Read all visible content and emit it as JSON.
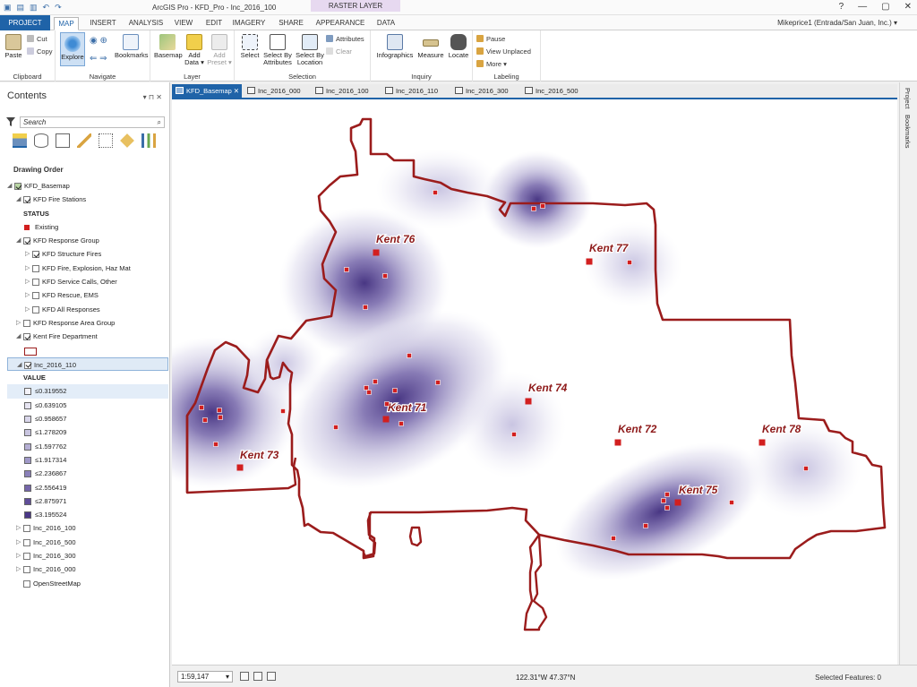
{
  "titlebar": {
    "title": "ArcGIS Pro - KFD_Pro - Inc_2016_100",
    "context_tab": "RASTER LAYER",
    "window_controls": [
      "?",
      "—",
      "▢",
      "✕"
    ]
  },
  "ribbon_tabs": [
    "PROJECT",
    "MAP",
    "INSERT",
    "ANALYSIS",
    "VIEW",
    "EDIT",
    "IMAGERY",
    "SHARE",
    "APPEARANCE",
    "DATA"
  ],
  "user": "Mikeprice1 (Entrada/San Juan, Inc.) ▾",
  "ribbon": {
    "clipboard": {
      "label": "Clipboard",
      "paste": "Paste",
      "cut": "Cut",
      "copy": "Copy"
    },
    "navigate": {
      "label": "Navigate",
      "explore": "Explore",
      "bookmarks": "Bookmarks"
    },
    "layer": {
      "label": "Layer",
      "basemap": "Basemap",
      "add_data": "Add Data ▾",
      "add_preset": "Add Preset ▾"
    },
    "selection": {
      "label": "Selection",
      "select": "Select",
      "select_by_attributes": "Select By Attributes",
      "select_by_location": "Select By Location",
      "attributes": "Attributes",
      "clear": "Clear"
    },
    "inquiry": {
      "label": "Inquiry",
      "infographics": "Infographics",
      "measure": "Measure",
      "locate": "Locate"
    },
    "labeling": {
      "label": "Labeling",
      "pause": "Pause",
      "view_unplaced": "View Unplaced",
      "more": "More ▾"
    }
  },
  "contents": {
    "title": "Contents",
    "search_placeholder": "Search",
    "drawing_order": "Drawing Order",
    "layers": [
      {
        "label": "KFD_Basemap",
        "checked": true,
        "indent": 0,
        "arrow": "◢",
        "kind": "map"
      },
      {
        "label": "KFD Fire Stations",
        "checked": true,
        "indent": 1,
        "arrow": "◢"
      },
      {
        "label": "STATUS",
        "indent": 1,
        "kind": "heading"
      },
      {
        "label": "Existing",
        "indent": 1,
        "kind": "legend",
        "color": "#d21f1f"
      },
      {
        "label": "KFD Response Group",
        "checked": true,
        "indent": 1,
        "arrow": "◢"
      },
      {
        "label": "KFD Structure Fires",
        "checked": true,
        "indent": 2,
        "arrow": "▷"
      },
      {
        "label": "KFD Fire, Explosion, Haz Mat",
        "checked": false,
        "indent": 2,
        "arrow": "▷"
      },
      {
        "label": "KFD Service Calls, Other",
        "checked": false,
        "indent": 2,
        "arrow": "▷"
      },
      {
        "label": "KFD Rescue, EMS",
        "checked": false,
        "indent": 2,
        "arrow": "▷"
      },
      {
        "label": "KFD All Responses",
        "checked": false,
        "indent": 2,
        "arrow": "▷"
      },
      {
        "label": "KFD Response Area Group",
        "checked": false,
        "indent": 1,
        "arrow": "▷"
      },
      {
        "label": "Kent Fire Department",
        "checked": true,
        "indent": 1,
        "arrow": "◢"
      },
      {
        "label": "",
        "indent": 1,
        "kind": "outline"
      },
      {
        "label": "Inc_2016_110",
        "checked": true,
        "indent": 1,
        "arrow": "◢",
        "selected": true
      },
      {
        "label": "VALUE",
        "indent": 1,
        "kind": "heading"
      },
      {
        "label": "≤0.319552",
        "indent": 1,
        "kind": "legend",
        "color": "#f4f3f9",
        "hl": true
      },
      {
        "label": "≤0.639105",
        "indent": 1,
        "kind": "legend",
        "color": "#e7e5f2"
      },
      {
        "label": "≤0.958657",
        "indent": 1,
        "kind": "legend",
        "color": "#d9d6ea"
      },
      {
        "label": "≤1.278209",
        "indent": 1,
        "kind": "legend",
        "color": "#c9c5e0"
      },
      {
        "label": "≤1.597762",
        "indent": 1,
        "kind": "legend",
        "color": "#b5afd4"
      },
      {
        "label": "≤1.917314",
        "indent": 1,
        "kind": "legend",
        "color": "#a099c8"
      },
      {
        "label": "≤2.236867",
        "indent": 1,
        "kind": "legend",
        "color": "#8a80b9"
      },
      {
        "label": "≤2.556419",
        "indent": 1,
        "kind": "legend",
        "color": "#7566aa"
      },
      {
        "label": "≤2.875971",
        "indent": 1,
        "kind": "legend",
        "color": "#5f4d99"
      },
      {
        "label": "≤3.195524",
        "indent": 1,
        "kind": "legend",
        "color": "#4a3787"
      },
      {
        "label": "Inc_2016_100",
        "checked": false,
        "indent": 1,
        "arrow": "▷"
      },
      {
        "label": "Inc_2016_500",
        "checked": false,
        "indent": 1,
        "arrow": "▷"
      },
      {
        "label": "Inc_2016_300",
        "checked": false,
        "indent": 1,
        "arrow": "▷"
      },
      {
        "label": "Inc_2016_000",
        "checked": false,
        "indent": 1,
        "arrow": "▷"
      },
      {
        "label": "OpenStreetMap",
        "checked": false,
        "indent": 1,
        "arrow": ""
      }
    ]
  },
  "map_tabs": [
    "KFD_Basemap",
    "Inc_2016_000",
    "Inc_2016_100",
    "Inc_2016_110",
    "Inc_2016_300",
    "Inc_2016_500"
  ],
  "right_strip": [
    "Project",
    "Bookmarks"
  ],
  "map": {
    "boundary_color": "#9b1c1c",
    "station_color": "#d21f1f",
    "stations": [
      "Kent 76",
      "Kent 77",
      "Kent 74",
      "Kent 71",
      "Kent 72",
      "Kent 78",
      "Kent 73",
      "Kent 75"
    ]
  },
  "status": {
    "scale": "1:59,147",
    "coords": "122.31°W 47.37°N",
    "selected": "Selected Features: 0"
  }
}
